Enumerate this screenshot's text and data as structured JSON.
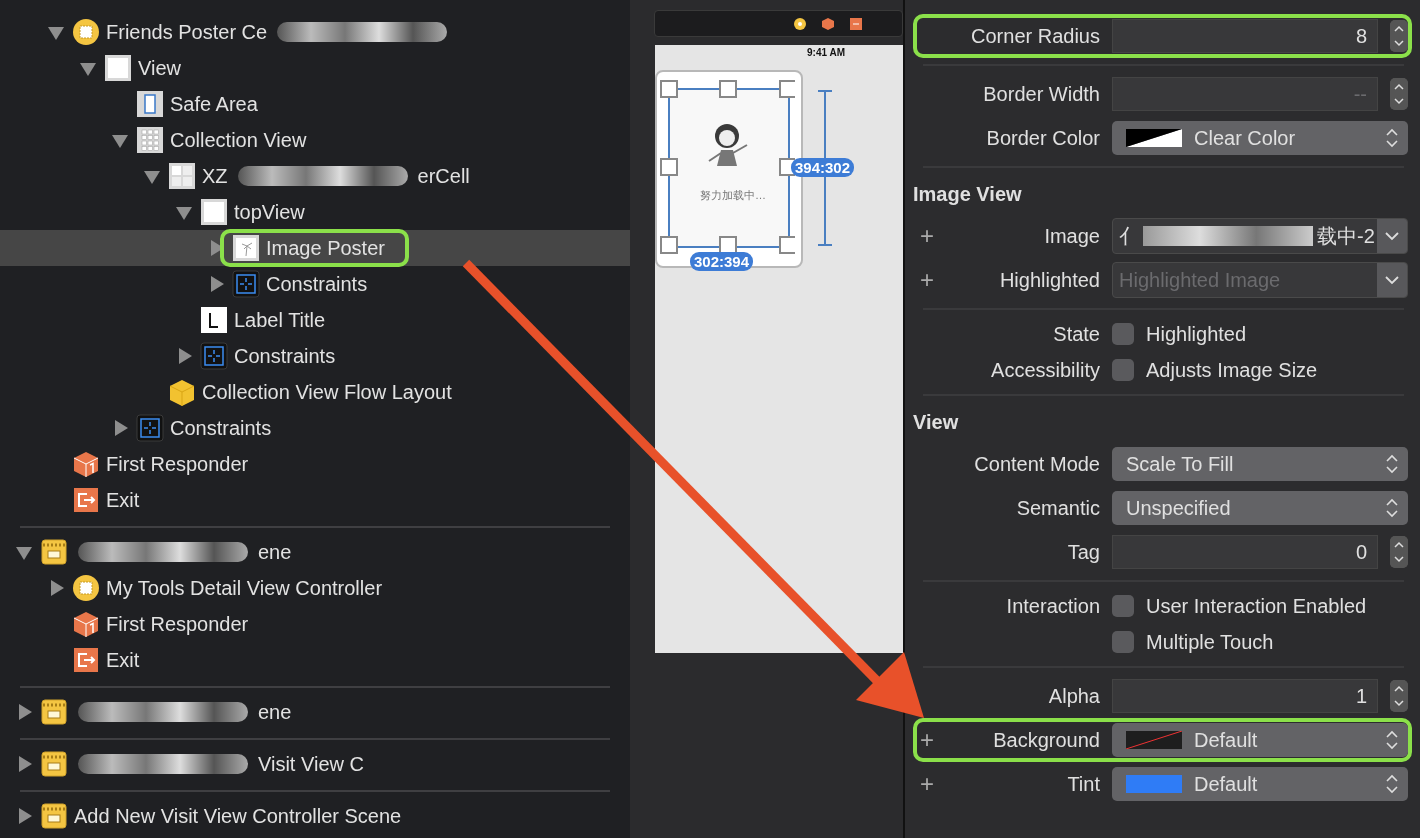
{
  "outline": {
    "sections": [
      {
        "items": [
          {
            "parts": [
              {
                "kind": "text",
                "text": "Friends Poster Ce"
              },
              {
                "kind": "redaction"
              }
            ],
            "kind": "controller",
            "expanded": true,
            "selected": false,
            "children": [
              {
                "label": "View",
                "kind": "view",
                "expanded": true,
                "selected": false,
                "children": [
                  {
                    "label": "Safe Area",
                    "kind": "safe-area",
                    "selected": false
                  },
                  {
                    "label": "Collection View",
                    "kind": "collection",
                    "expanded": true,
                    "selected": false,
                    "children": [
                      {
                        "parts": [
                          {
                            "kind": "text",
                            "text": "XZ"
                          },
                          {
                            "kind": "redaction"
                          },
                          {
                            "kind": "text",
                            "text": "erCell"
                          }
                        ],
                        "kind": "cell",
                        "expanded": true,
                        "selected": false,
                        "children": [
                          {
                            "label": "topView",
                            "kind": "view",
                            "expanded": true,
                            "selected": false,
                            "children": [
                              {
                                "label": "Image Poster",
                                "kind": "image",
                                "expanded": false,
                                "selected": true,
                                "outlined": true
                              },
                              {
                                "label": "Constraints",
                                "kind": "constraints",
                                "expanded": false,
                                "selected": false
                              }
                            ]
                          },
                          {
                            "label": "Label Title",
                            "kind": "label",
                            "selected": false
                          },
                          {
                            "label": "Constraints",
                            "kind": "constraints",
                            "expanded": false,
                            "selected": false
                          }
                        ]
                      },
                      {
                        "label": "Collection View Flow Layout",
                        "kind": "flow-layout",
                        "selected": false
                      }
                    ]
                  },
                  {
                    "label": "Constraints",
                    "kind": "constraints",
                    "expanded": false,
                    "selected": false
                  }
                ]
              }
            ]
          },
          {
            "label": "First Responder",
            "kind": "responder",
            "selected": false
          },
          {
            "label": "Exit",
            "kind": "exit",
            "selected": false
          }
        ]
      },
      {
        "header": {
          "parts": [
            {
              "kind": "redaction"
            },
            {
              "kind": "text",
              "text": "ene"
            }
          ],
          "kind": "scene",
          "expanded": true,
          "selected": false
        },
        "items": [
          {
            "label": "My Tools Detail View Controller",
            "kind": "controller",
            "expanded": false,
            "selected": false
          },
          {
            "label": "First Responder",
            "kind": "responder",
            "selected": false
          },
          {
            "label": "Exit",
            "kind": "exit",
            "selected": false
          }
        ]
      },
      {
        "header": {
          "parts": [
            {
              "kind": "redaction"
            },
            {
              "kind": "text",
              "text": "ene"
            }
          ],
          "kind": "scene",
          "expanded": false,
          "selected": false
        }
      },
      {
        "header": {
          "parts": [
            {
              "kind": "redaction"
            },
            {
              "kind": "text",
              "text": "Visit View C"
            }
          ],
          "kind": "scene",
          "expanded": false,
          "selected": false
        }
      },
      {
        "header": {
          "label": "Add New Visit View Controller Scene",
          "kind": "scene",
          "expanded": false,
          "selected": false
        }
      }
    ]
  },
  "canvas": {
    "time": "9:41 AM",
    "loading_text": "努力加载中…",
    "height_badge": "394:302",
    "width_badge": "302:394"
  },
  "inspector": {
    "rows": [
      {
        "kind": "stepper",
        "label": "Corner Radius",
        "value": "8",
        "outlined": true
      },
      {
        "kind": "divider"
      },
      {
        "kind": "stepper",
        "label": "Border Width",
        "placeholder": "--"
      },
      {
        "kind": "clear-color",
        "label": "Border Color",
        "value": "Clear Color"
      },
      {
        "kind": "divider"
      },
      {
        "kind": "header",
        "label": "Image View"
      },
      {
        "kind": "combo",
        "label": "Image",
        "plus": "+",
        "parts": [
          {
            "kind": "text",
            "text": "亻"
          },
          {
            "kind": "redaction"
          },
          {
            "kind": "text",
            "text": "载中-2"
          }
        ]
      },
      {
        "kind": "combo",
        "label": "Highlighted",
        "plus": "+",
        "placeholder": "Highlighted Image"
      },
      {
        "kind": "divider"
      },
      {
        "kind": "checkbox",
        "label": "State",
        "text": "Highlighted",
        "checked": false
      },
      {
        "kind": "checkbox",
        "label": "Accessibility",
        "text": "Adjusts Image Size",
        "checked": false
      },
      {
        "kind": "divider"
      },
      {
        "kind": "header",
        "label": "View"
      },
      {
        "kind": "popup",
        "label": "Content Mode",
        "value": "Scale To Fill"
      },
      {
        "kind": "popup",
        "label": "Semantic",
        "value": "Unspecified"
      },
      {
        "kind": "stepper",
        "label": "Tag",
        "value": "0"
      },
      {
        "kind": "divider"
      },
      {
        "kind": "checkbox",
        "label": "Interaction",
        "text": "User Interaction Enabled",
        "checked": false
      },
      {
        "kind": "checkbox",
        "text": "Multiple Touch",
        "checked": false
      },
      {
        "kind": "divider"
      },
      {
        "kind": "stepper",
        "label": "Alpha",
        "value": "1"
      },
      {
        "kind": "default-color",
        "label": "Background",
        "plus": "+",
        "value": "Default",
        "outlined": true
      },
      {
        "kind": "color",
        "label": "Tint",
        "plus": "+",
        "color": "#2f7cf6",
        "value": "Default"
      }
    ]
  }
}
